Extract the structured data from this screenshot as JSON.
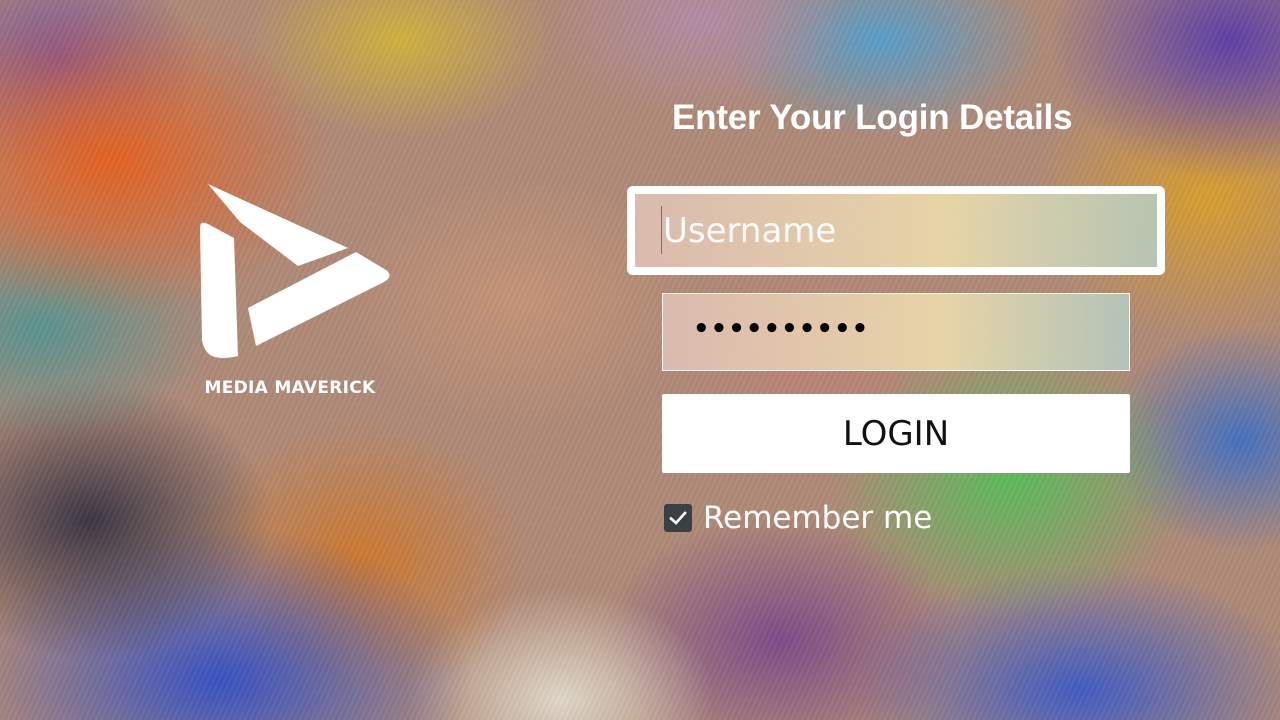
{
  "brand": {
    "name": "MEDIA MAVERICK",
    "logo_icon": "play-triangle-logo",
    "logo_color": "#ffffff"
  },
  "login": {
    "title": "Enter Your Login Details",
    "username": {
      "placeholder": "Username",
      "value": ""
    },
    "password": {
      "masked_value": "••••••••••"
    },
    "login_button_label": "LOGIN",
    "remember_me": {
      "label": "Remember me",
      "checked": true,
      "check_icon": "checkmark-icon"
    }
  },
  "colors": {
    "focus_border": "#ffffff",
    "button_bg": "#ffffff",
    "checkbox_bg": "#3b3f46"
  }
}
